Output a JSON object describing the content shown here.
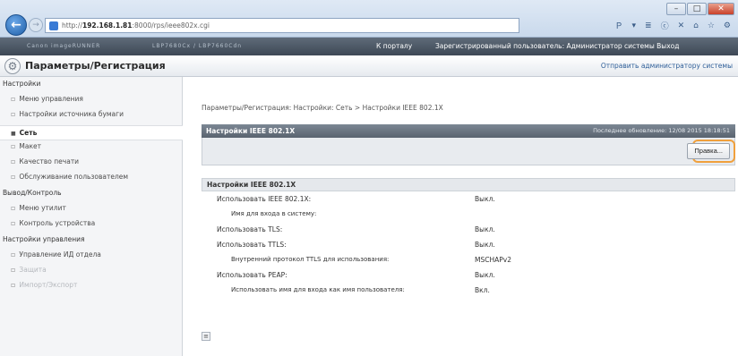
{
  "browser": {
    "url_prefix": "http://",
    "url_host": "192.168.1.81",
    "url_rest": ":8000/rps/ieee802x.cgi",
    "tools": [
      "Ｐ",
      "▾",
      "≣",
      "ⓒ",
      "✕",
      "⌂",
      "☆",
      "⚙"
    ],
    "win_minimize": "–",
    "win_maximize": "□",
    "win_close": "✕"
  },
  "topbar": {
    "brand_blur_1": "Canon imageRUNNER",
    "brand_blur_2": "LBP7680Cx / LBP7660Cdn",
    "portal_link": "К порталу",
    "user_info": "Зарегистрированный пользователь: Администратор системы   Выход"
  },
  "header": {
    "title": "Параметры/Регистрация",
    "mail_admin": "Отправить администратору системы"
  },
  "sidebar": {
    "items": [
      {
        "label": "Настройки",
        "kind": "section"
      },
      {
        "label": "Меню управления",
        "kind": "sub"
      },
      {
        "label": "Настройки источника бумаги",
        "kind": "sub"
      },
      {
        "label": "Сеть",
        "kind": "active"
      },
      {
        "label": "Макет",
        "kind": "sub"
      },
      {
        "label": "Качество печати",
        "kind": "sub"
      },
      {
        "label": "Обслуживание пользователем",
        "kind": "sub"
      },
      {
        "label": "Вывод/Контроль",
        "kind": "section"
      },
      {
        "label": "Меню утилит",
        "kind": "sub"
      },
      {
        "label": "Контроль устройства",
        "kind": "sub"
      },
      {
        "label": "Настройки управления",
        "kind": "section"
      },
      {
        "label": "Управление ИД отдела",
        "kind": "sub"
      },
      {
        "label": "Защита",
        "kind": "faded"
      },
      {
        "label": "Импорт/Экспорт",
        "kind": "faded"
      }
    ]
  },
  "main": {
    "breadcrumb": "Параметры/Регистрация: Настройки: Сеть > Настройки IEEE 802.1X",
    "panel_title": "Настройки IEEE 802.1X",
    "last_updated": "Последнее обновление: 12/08 2015 18:18:51",
    "edit_button": "Правка...",
    "settings_title": "Настройки IEEE 802.1X",
    "rows": [
      {
        "label": "Использовать IEEE 802.1X:",
        "value": "Выкл.",
        "indent": false
      },
      {
        "label": "Имя для входа в систему:",
        "value": "",
        "indent": true
      },
      {
        "label": "Использовать TLS:",
        "value": "Выкл.",
        "indent": false
      },
      {
        "label": "Использовать TTLS:",
        "value": "Выкл.",
        "indent": false
      },
      {
        "label": "Внутренний протокол TTLS для использования:",
        "value": "MSCHAPv2",
        "indent": true
      },
      {
        "label": "Использовать PEAP:",
        "value": "Выкл.",
        "indent": false
      },
      {
        "label": "Использовать имя для входа как имя пользователя:",
        "value": "Вкл.",
        "indent": true
      }
    ],
    "scroll_marker": "≡"
  }
}
